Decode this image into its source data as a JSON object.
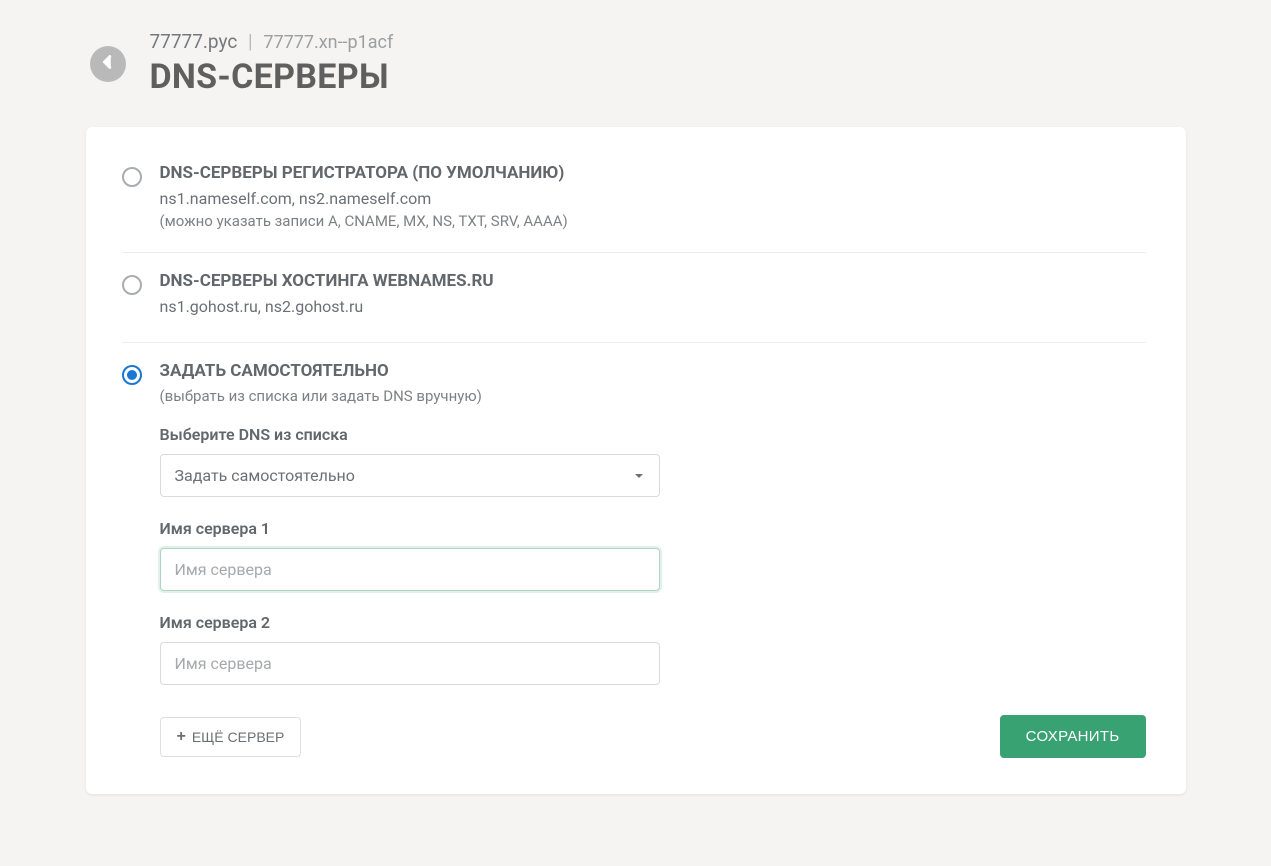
{
  "header": {
    "domain_primary": "77777.рус",
    "separator": "|",
    "domain_secondary": "77777.xn--p1acf",
    "page_title": "DNS-СЕРВЕРЫ"
  },
  "options": {
    "registrar": {
      "title": "DNS-СЕРВЕРЫ РЕГИСТРАТОРА (ПО УМОЛЧАНИЮ)",
      "servers": "ns1.nameself.com, ns2.nameself.com",
      "hint": "(можно указать записи A, CNAME, MX, NS, TXT, SRV, AAAA)",
      "selected": false
    },
    "hosting": {
      "title": "DNS-СЕРВЕРЫ ХОСТИНГА WEBNAMES.RU",
      "servers": "ns1.gohost.ru, ns2.gohost.ru",
      "selected": false
    },
    "custom": {
      "title": "ЗАДАТЬ САМОСТОЯТЕЛЬНО",
      "hint": "(выбрать из списка или задать DNS вручную)",
      "selected": true
    }
  },
  "custom_form": {
    "select_label": "Выберите DNS из списка",
    "select_value": "Задать самостоятельно",
    "server1_label": "Имя сервера 1",
    "server1_placeholder": "Имя сервера",
    "server1_value": "",
    "server2_label": "Имя сервера 2",
    "server2_placeholder": "Имя сервера",
    "server2_value": ""
  },
  "buttons": {
    "add_server": "ЕЩЁ СЕРВЕР",
    "save": "СОХРАНИТЬ"
  }
}
